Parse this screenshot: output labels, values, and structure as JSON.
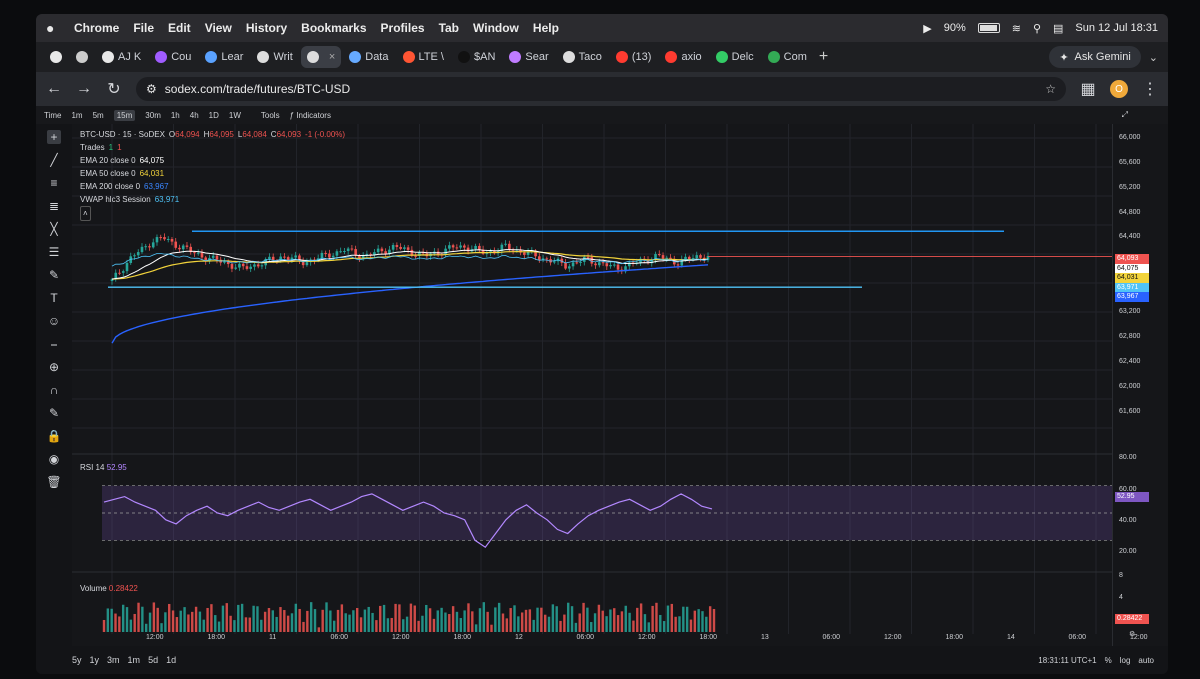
{
  "menubar": {
    "app": "Chrome",
    "items": [
      "File",
      "Edit",
      "View",
      "History",
      "Bookmarks",
      "Profiles",
      "Tab",
      "Window",
      "Help"
    ],
    "battery": "90%",
    "datetime": "Sun 12 Jul  18:31"
  },
  "tabs": [
    {
      "label": "AJ K",
      "color": "#e8e8e8"
    },
    {
      "label": "Cou",
      "color": "#a05cff"
    },
    {
      "label": "Lear",
      "color": "#5aa2ff"
    },
    {
      "label": "Writ",
      "color": "#dddddd"
    },
    {
      "label": "",
      "color": "#dddddd",
      "active": true
    },
    {
      "label": "Data",
      "color": "#66aaff"
    },
    {
      "label": "LTE \\",
      "color": "#ff5533"
    },
    {
      "label": "$AN",
      "color": "#111111"
    },
    {
      "label": "Sear",
      "color": "#c07cff"
    },
    {
      "label": "Taco",
      "color": "#dddddd"
    },
    {
      "label": "(13)",
      "color": "#ff3b30"
    },
    {
      "label": "axio",
      "color": "#ff3b30"
    },
    {
      "label": "Delc",
      "color": "#33cc66"
    },
    {
      "label": "Com",
      "color": "#33aa55"
    }
  ],
  "ask_gemini": "Ask Gemini",
  "address": {
    "url": "sodex.com/trade/futures/BTC-USD",
    "avatar": "O"
  },
  "toolbar": {
    "timeframes": [
      "Time",
      "1m",
      "5m",
      "15m",
      "30m",
      "1h",
      "4h",
      "1D",
      "1W"
    ],
    "selected": "15m",
    "tools": "Tools",
    "indicators": "Indicators"
  },
  "legend": {
    "symbol": "BTC-USD · 15 · SoDEX",
    "o": "64,094",
    "h": "64,095",
    "l": "64,084",
    "c": "64,093",
    "chg": "-1 (-0.00%)",
    "trades_label": "Trades",
    "trades_a": "1",
    "trades_b": "1",
    "ema20_label": "EMA 20 close 0",
    "ema20": "64,075",
    "ema50_label": "EMA 50 close 0",
    "ema50": "64,031",
    "ema200_label": "EMA 200 close 0",
    "ema200": "63,967",
    "vwap_label": "VWAP hlc3 Session",
    "vwap": "63,971"
  },
  "rsi": {
    "label": "RSI 14",
    "value": "52.95"
  },
  "volume": {
    "label": "Volume",
    "value": "0.28422"
  },
  "price_scale": [
    "66,000",
    "65,600",
    "65,200",
    "64,800",
    "64,400",
    "63,200",
    "62,800",
    "62,400",
    "62,000",
    "61,600"
  ],
  "price_tags": [
    {
      "v": "64,093",
      "color": "#ef5350"
    },
    {
      "v": "64,075",
      "color": "#ffffff"
    },
    {
      "v": "64,031",
      "color": "#f2d33b"
    },
    {
      "v": "63,971",
      "color": "#4fc3f7"
    },
    {
      "v": "63,967",
      "color": "#2962ff"
    }
  ],
  "rsi_scale": [
    "80.00",
    "60.00",
    "40.00",
    "20.00"
  ],
  "vol_scale": [
    "8",
    "4",
    "0.28422"
  ],
  "time_axis": [
    "12:00",
    "18:00",
    "11",
    "06:00",
    "12:00",
    "18:00",
    "12",
    "06:00",
    "12:00",
    "18:00",
    "13",
    "06:00",
    "12:00",
    "18:00",
    "14",
    "06:00",
    "12:00"
  ],
  "ranges": [
    "5y",
    "1y",
    "3m",
    "1m",
    "5d",
    "1d"
  ],
  "bottom_right": {
    "clock": "18:31:11 UTC+1",
    "pct": "%",
    "log": "log",
    "auto": "auto"
  },
  "colors": {
    "ema20": "#ffffff",
    "ema50": "#f2d33b",
    "ema200": "#2962ff",
    "vwap": "#4fc3f7",
    "rsi": "#b388ff",
    "up": "#26a69a",
    "down": "#ef5350"
  },
  "chart_data": {
    "type": "candlestick",
    "symbol": "BTC-USD",
    "interval": "15m",
    "ylim": [
      61400,
      66000
    ],
    "last_price": 64093,
    "horizontal_lines": [
      64500,
      63600
    ],
    "price_path": [
      63700,
      63900,
      64100,
      64200,
      64350,
      64400,
      64300,
      64250,
      64150,
      64100,
      64050,
      64000,
      63950,
      63900,
      63950,
      64000,
      64050,
      64100,
      64050,
      64000,
      64050,
      64100,
      64150,
      64200,
      64150,
      64100,
      64150,
      64200,
      64250,
      64200,
      64150,
      64100,
      64150,
      64200,
      64250,
      64250,
      64200,
      64150,
      64200,
      64250,
      64200,
      64150,
      64100,
      64050,
      64000,
      63950,
      64000,
      64050,
      64000,
      63950,
      63900,
      63950,
      64000,
      64050,
      64100,
      64050,
      64000,
      64050,
      64100,
      64093
    ],
    "rsi": [
      58,
      60,
      62,
      58,
      55,
      52,
      45,
      42,
      48,
      52,
      55,
      50,
      48,
      52,
      55,
      58,
      54,
      52,
      55,
      58,
      60,
      56,
      52,
      55,
      58,
      62,
      64,
      60,
      56,
      52,
      55,
      58,
      55,
      50,
      48,
      45,
      30,
      25,
      35,
      45,
      52,
      56,
      50,
      45,
      38,
      35,
      42,
      48,
      52,
      55,
      58,
      60,
      56,
      52,
      55,
      60,
      64,
      60,
      55,
      53
    ],
    "rsi_ylim": [
      20,
      80
    ],
    "volume_ylim": [
      0,
      10
    ]
  }
}
